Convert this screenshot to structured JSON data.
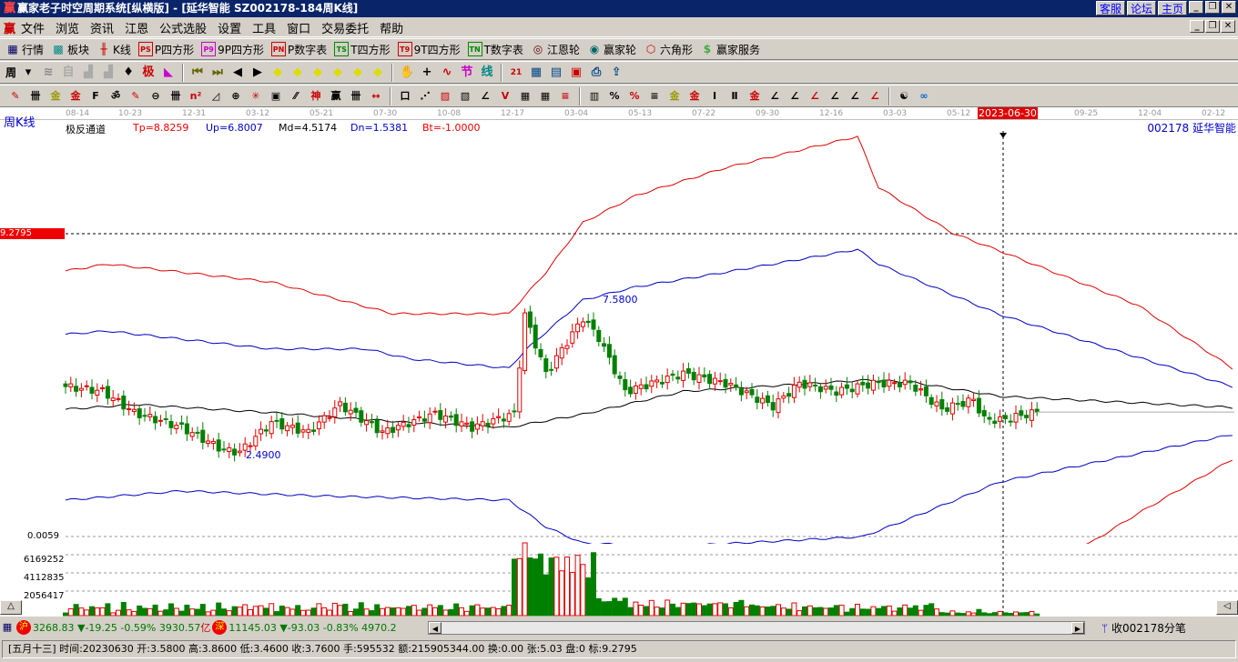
{
  "title": "赢家老子时空周期系统[纵横版] - [延华智能   SZ002178-184周K线]",
  "title_links": [
    "客服",
    "论坛",
    "主页"
  ],
  "menu": [
    "文件",
    "浏览",
    "资讯",
    "江恩",
    "公式选股",
    "设置",
    "工具",
    "窗口",
    "交易委托",
    "帮助"
  ],
  "toolbar1": [
    {
      "label": "行情",
      "icon": "grid-table-icon",
      "glyph": "▦",
      "color": "#006"
    },
    {
      "label": "板块",
      "icon": "blocks-icon",
      "glyph": "▩",
      "color": "#088"
    },
    {
      "label": "K线",
      "icon": "candlestick-icon",
      "glyph": "╫",
      "color": "#c00"
    },
    {
      "label": "P四方形",
      "icon": "ps-icon",
      "glyph": "PS",
      "color": "#c00"
    },
    {
      "label": "9P四方形",
      "icon": "p9-icon",
      "glyph": "P9",
      "color": "#c0c"
    },
    {
      "label": "P数字表",
      "icon": "pn-icon",
      "glyph": "PN",
      "color": "#c00"
    },
    {
      "label": "T四方形",
      "icon": "ts-icon",
      "glyph": "TS",
      "color": "#080"
    },
    {
      "label": "9T四方形",
      "icon": "t9-icon",
      "glyph": "T9",
      "color": "#c00"
    },
    {
      "label": "T数字表",
      "icon": "tn-icon",
      "glyph": "TN",
      "color": "#080"
    },
    {
      "label": "江恩轮",
      "icon": "gann-wheel-icon",
      "glyph": "◎",
      "color": "#600"
    },
    {
      "label": "赢家轮",
      "icon": "winner-wheel-icon",
      "glyph": "◉",
      "color": "#066"
    },
    {
      "label": "六角形",
      "icon": "hexagon-icon",
      "glyph": "⬡",
      "color": "#c00"
    },
    {
      "label": "赢家服务",
      "icon": "dollar-icon",
      "glyph": "$",
      "color": "#4a4"
    }
  ],
  "period_select": "周",
  "toolbar2_icons": [
    {
      "name": "dropdown-icon",
      "g": "▾",
      "c": "#000"
    },
    {
      "name": "pattern-icon",
      "g": "≋",
      "c": "#888"
    },
    {
      "name": "notes-icon",
      "g": "自",
      "c": "#aaa"
    },
    {
      "name": "chart-small-icon",
      "g": "▟",
      "c": "#aaa"
    },
    {
      "name": "chart-small2-icon",
      "g": "▟",
      "c": "#aaa"
    },
    {
      "name": "bar-type-icon",
      "g": "♦",
      "c": "#000"
    },
    {
      "name": "ji-icon",
      "g": "极",
      "c": "#c00"
    },
    {
      "name": "fan-icon",
      "g": "◣",
      "c": "#c0c"
    },
    {
      "name": "first-icon",
      "g": "⏮",
      "c": "#660"
    },
    {
      "name": "last-icon",
      "g": "⏭",
      "c": "#660"
    },
    {
      "name": "left-icon",
      "g": "◀",
      "c": "#000"
    },
    {
      "name": "right-icon",
      "g": "▶",
      "c": "#000"
    },
    {
      "name": "move-left-icon",
      "g": "◆",
      "c": "#dd0"
    },
    {
      "name": "move-right-icon",
      "g": "◆",
      "c": "#dd0"
    },
    {
      "name": "expand-icon",
      "g": "◆",
      "c": "#dd0"
    },
    {
      "name": "shrink-icon",
      "g": "◆",
      "c": "#dd0"
    },
    {
      "name": "zoom-icon",
      "g": "◆",
      "c": "#dd0"
    },
    {
      "name": "fit-icon",
      "g": "◆",
      "c": "#dd0"
    },
    {
      "name": "hand-icon",
      "g": "✋",
      "c": "#000"
    },
    {
      "name": "crosshair-icon",
      "g": "+",
      "c": "#000"
    },
    {
      "name": "wave-icon",
      "g": "∿",
      "c": "#c00"
    },
    {
      "name": "jie-icon",
      "g": "节",
      "c": "#c0c"
    },
    {
      "name": "xian-icon",
      "g": "线",
      "c": "#088"
    },
    {
      "name": "calendar-icon",
      "g": "21",
      "c": "#c00"
    },
    {
      "name": "calculator-icon",
      "g": "▦",
      "c": "#048"
    },
    {
      "name": "report-icon",
      "g": "▤",
      "c": "#048"
    },
    {
      "name": "save-icon",
      "g": "▣",
      "c": "#c00"
    },
    {
      "name": "print-icon",
      "g": "⎙",
      "c": "#048"
    },
    {
      "name": "export-icon",
      "g": "⇪",
      "c": "#048"
    }
  ],
  "toolbar3_icons": [
    "pen-icon",
    "parallel-icon",
    "gold-icon",
    "gold2-icon",
    "f-icon",
    "spiral-icon",
    "brush-icon",
    "circle-icon",
    "lines-icon",
    "n2-icon",
    "triangle-icon",
    "target-icon",
    "star-icon",
    "square-icon",
    "slash-icon",
    "shen-icon",
    "ying-icon",
    "comb-icon",
    "span-icon",
    "box-icon",
    "fan-lines-icon",
    "fan-box-icon",
    "fan-box2-icon",
    "angle-icon",
    "vee-icon",
    "grid-icon",
    "grid2-icon",
    "hatch-icon",
    "bars-icon",
    "percent-fan-icon",
    "percent-icon",
    "percent-lines-icon",
    "gold-circle-icon",
    "gold-lines-icon",
    "arrow-icon",
    "ab-icon",
    "gold3-icon",
    "j-angle-icon",
    "f-angle-icon",
    "gold-angle-icon",
    "shen-angle-icon",
    "ying-angle-icon",
    "si-angle-icon",
    "yinyang-icon",
    "infinity-icon"
  ],
  "date_axis": [
    "08-14",
    "10-23",
    "12-31",
    "03-12",
    "05-21",
    "07-30",
    "10-08",
    "12-17",
    "03-04",
    "05-13",
    "07-22",
    "09-30",
    "12-16",
    "03-03",
    "05-12",
    "2023-06-30",
    "09-25",
    "12-04",
    "02-12"
  ],
  "chart": {
    "period_label": "周K线",
    "indicator": {
      "name": "极反通道",
      "tp": "Tp=8.8259",
      "up": "Up=6.8007",
      "md": "Md=4.5174",
      "dn": "Dn=1.5381",
      "bt": "Bt=-1.0000"
    },
    "stock": "002178  延华智能",
    "cursor_price": "9.2795",
    "price_axis_bottom": "0.0059",
    "high_label": "7.5800",
    "low_label": "2.4900",
    "volume_axis": [
      "6169252",
      "4112835",
      "2056417"
    ],
    "colors": {
      "up": "#e00000",
      "down": "#008000",
      "tp": "#e00000",
      "upband": "#0000c0",
      "md": "#000000",
      "dn": "#0000c0",
      "bt": "#e00000"
    }
  },
  "chart_data": {
    "type": "candlestick",
    "weeks": 184,
    "price_range": [
      0.0059,
      9.2795
    ],
    "close_keypoints": [
      [
        0,
        4.6
      ],
      [
        7,
        4.46
      ],
      [
        13,
        3.8
      ],
      [
        22,
        3.35
      ],
      [
        30,
        2.65
      ],
      [
        33,
        2.6
      ],
      [
        39,
        3.5
      ],
      [
        46,
        3.2
      ],
      [
        52,
        4.05
      ],
      [
        60,
        3.2
      ],
      [
        70,
        3.77
      ],
      [
        77,
        3.35
      ],
      [
        85,
        3.77
      ],
      [
        87,
        6.8
      ],
      [
        91,
        5.0
      ],
      [
        98,
        6.7
      ],
      [
        101,
        6.1
      ],
      [
        106,
        4.45
      ],
      [
        117,
        5.0
      ],
      [
        125,
        4.7
      ],
      [
        134,
        4.0
      ],
      [
        139,
        4.7
      ],
      [
        146,
        4.45
      ],
      [
        153,
        4.7
      ],
      [
        160,
        4.7
      ],
      [
        166,
        3.9
      ],
      [
        172,
        4.2
      ],
      [
        174,
        3.6
      ],
      [
        177,
        3.57
      ],
      [
        184,
        3.82
      ]
    ],
    "md_keypoints": [
      [
        0,
        3.9
      ],
      [
        13,
        4.05
      ],
      [
        39,
        3.8
      ],
      [
        65,
        3.5
      ],
      [
        84,
        3.35
      ],
      [
        98,
        3.75
      ],
      [
        117,
        4.45
      ],
      [
        152,
        4.8
      ],
      [
        160,
        4.74
      ],
      [
        177,
        4.3
      ],
      [
        221,
        3.96
      ]
    ],
    "up_keypoints": [
      [
        0,
        6.2
      ],
      [
        8,
        6.3
      ],
      [
        39,
        5.75
      ],
      [
        57,
        5.75
      ],
      [
        65,
        5.45
      ],
      [
        84,
        5.16
      ],
      [
        87,
        5.7
      ],
      [
        98,
        7.25
      ],
      [
        108,
        7.65
      ],
      [
        125,
        8.1
      ],
      [
        150,
        8.8
      ],
      [
        154,
        8.35
      ],
      [
        177,
        6.8
      ],
      [
        194,
        5.95
      ],
      [
        221,
        4.6
      ]
    ],
    "tp_keypoints": [
      [
        0,
        8.14
      ],
      [
        8,
        8.35
      ],
      [
        39,
        7.8
      ],
      [
        62,
        6.83
      ],
      [
        84,
        6.83
      ],
      [
        91,
        8.1
      ],
      [
        98,
        9.62
      ],
      [
        108,
        10.45
      ],
      [
        125,
        11.3
      ],
      [
        150,
        12.26
      ],
      [
        154,
        10.7
      ],
      [
        168,
        9.3
      ],
      [
        177,
        8.75
      ],
      [
        203,
        7.1
      ],
      [
        221,
        5.16
      ]
    ],
    "dn_keypoints": [
      [
        0,
        1.12
      ],
      [
        22,
        1.4
      ],
      [
        48,
        1.25
      ],
      [
        84,
        1.12
      ],
      [
        91,
        0.3
      ],
      [
        98,
        -0.2
      ],
      [
        115,
        -0.3
      ],
      [
        151,
        0.0
      ],
      [
        160,
        0.56
      ],
      [
        177,
        1.68
      ],
      [
        221,
        3.13
      ]
    ],
    "bt_keypoints": [
      [
        0,
        -3
      ],
      [
        150,
        -2
      ],
      [
        194,
        -0.2
      ],
      [
        203,
        0.7
      ],
      [
        221,
        2.37
      ]
    ],
    "volume_axis": [
      2056417,
      4112835,
      6169252
    ]
  },
  "status1": {
    "sh_badge": "沪",
    "sh": "3268.83",
    "sh_chg": "▼-19.25 -0.59% 3930.57",
    "yi": "亿",
    "sz_badge": "深",
    "sz": "11145.03",
    "sz_chg": "▼-93.03 -0.83% 4970.2",
    "right": "收002178分笔"
  },
  "status2": "[五月十三] 时间:20230630 开:3.5800 高:3.8600 低:3.4600 收:3.7600 手:595532 额:215905344.00 换:0.00 张:5.03 盘:0 标:9.2795"
}
